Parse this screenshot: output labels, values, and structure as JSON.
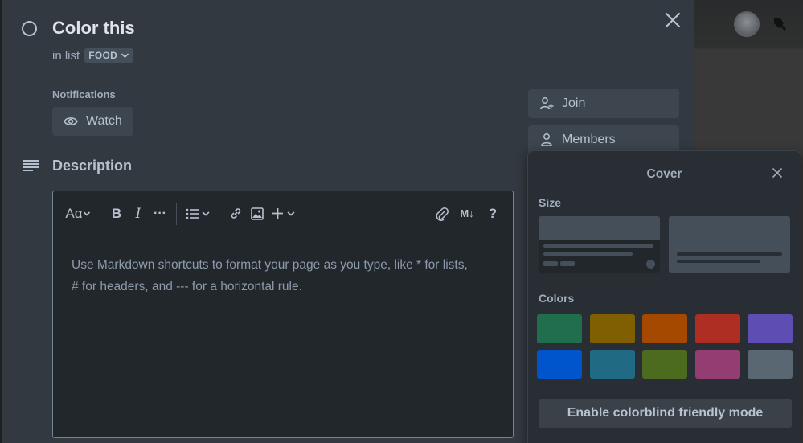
{
  "card": {
    "title": "Color this",
    "in_list_prefix": "in list",
    "list_name": "FOOD"
  },
  "notifications": {
    "label": "Notifications",
    "watch_label": "Watch"
  },
  "description": {
    "heading": "Description",
    "placeholder_line1": "Use Markdown shortcuts to format your page as you type, like * for lists,",
    "placeholder_line2": "# for headers, and --- for a horizontal rule."
  },
  "editor_toolbar": {
    "text_style_label": "Aα",
    "bold_label": "B",
    "italic_label": "I",
    "more_label": "···",
    "markdown_label": "M↓",
    "help_label": "?"
  },
  "sidebar": {
    "join_label": "Join",
    "members_label": "Members"
  },
  "cover_popover": {
    "title": "Cover",
    "size_label": "Size",
    "colors_label": "Colors",
    "colorblind_button": "Enable colorblind friendly mode",
    "colors": [
      "#216e4e",
      "#7f5f01",
      "#a54800",
      "#ae2e24",
      "#5e4db2",
      "#0055cc",
      "#206a83",
      "#4c6b1f",
      "#943d73",
      "#596773"
    ]
  },
  "icons": {
    "status": "circle-icon",
    "close": "close-icon",
    "watch": "eye-icon",
    "description": "text-lines-icon",
    "join": "person-add-icon",
    "members": "person-icon"
  }
}
